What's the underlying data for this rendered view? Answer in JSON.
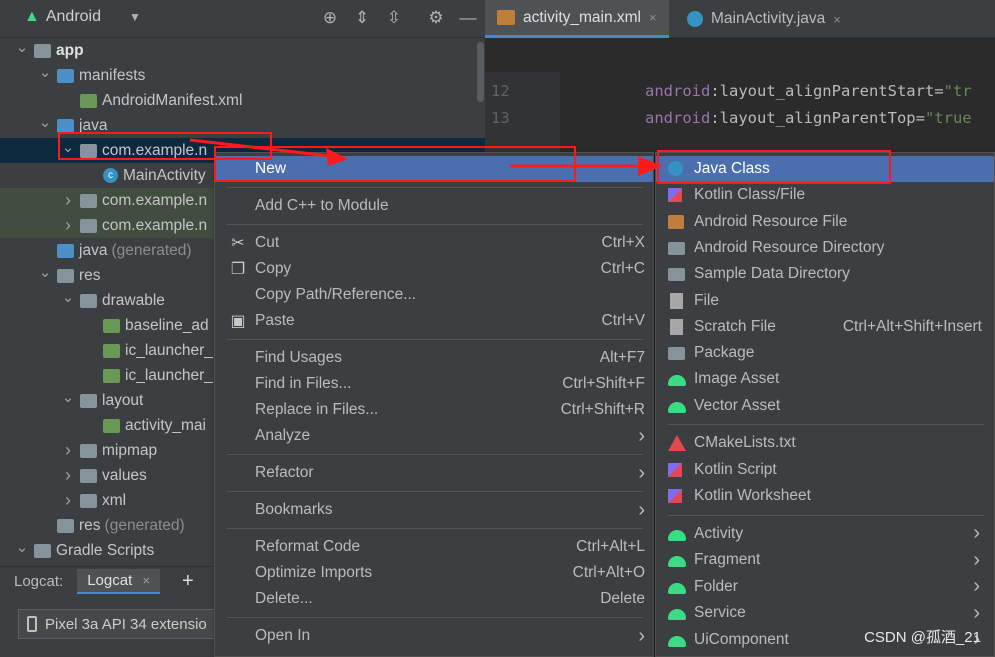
{
  "project_header": {
    "title": "Android",
    "icons": [
      "android-icon",
      "chevron-down-icon",
      "crosshair-icon",
      "expand-icon",
      "collapse-icon",
      "gear-icon",
      "minimize-icon"
    ]
  },
  "tree": [
    {
      "label": "app",
      "depth": 0,
      "arrow": "expanded",
      "icon": "module"
    },
    {
      "label": "manifests",
      "depth": 1,
      "arrow": "expanded",
      "icon": "folder-blue"
    },
    {
      "label": "AndroidManifest.xml",
      "depth": 2,
      "arrow": "",
      "icon": "manifest"
    },
    {
      "label": "java",
      "depth": 1,
      "arrow": "expanded",
      "icon": "folder-blue"
    },
    {
      "label": "com.example.n",
      "depth": 2,
      "arrow": "expanded",
      "icon": "package",
      "selected": true
    },
    {
      "label": "MainActivity",
      "depth": 3,
      "arrow": "",
      "icon": "java"
    },
    {
      "label": "com.example.n",
      "depth": 2,
      "arrow": "collapsed",
      "icon": "package",
      "green": true
    },
    {
      "label": "com.example.n",
      "depth": 2,
      "arrow": "collapsed",
      "icon": "package",
      "green": true
    },
    {
      "label": "java",
      "muted": "(generated)",
      "depth": 1,
      "arrow": "",
      "icon": "folder-gen"
    },
    {
      "label": "res",
      "depth": 1,
      "arrow": "expanded",
      "icon": "folder-res"
    },
    {
      "label": "drawable",
      "depth": 2,
      "arrow": "expanded",
      "icon": "folder"
    },
    {
      "label": "baseline_ad",
      "depth": 3,
      "arrow": "",
      "icon": "xml"
    },
    {
      "label": "ic_launcher_",
      "depth": 3,
      "arrow": "",
      "icon": "xml"
    },
    {
      "label": "ic_launcher_",
      "depth": 3,
      "arrow": "",
      "icon": "xml"
    },
    {
      "label": "layout",
      "depth": 2,
      "arrow": "expanded",
      "icon": "folder"
    },
    {
      "label": "activity_mai",
      "depth": 3,
      "arrow": "",
      "icon": "xml"
    },
    {
      "label": "mipmap",
      "depth": 2,
      "arrow": "collapsed",
      "icon": "folder"
    },
    {
      "label": "values",
      "depth": 2,
      "arrow": "collapsed",
      "icon": "folder"
    },
    {
      "label": "xml",
      "depth": 2,
      "arrow": "collapsed",
      "icon": "folder"
    },
    {
      "label": "res",
      "muted": "(generated)",
      "depth": 1,
      "arrow": "",
      "icon": "folder-res"
    },
    {
      "label": "Gradle Scripts",
      "depth": 0,
      "arrow": "expanded",
      "icon": "gradle"
    }
  ],
  "logcat": {
    "label": "Logcat:",
    "tab": "Logcat",
    "close": "×",
    "add": "+",
    "device": "Pixel 3a API 34 extensio"
  },
  "editor_tabs": [
    {
      "label": "activity_main.xml",
      "close": "×",
      "active": true
    },
    {
      "label": "MainActivity.java",
      "close": "×",
      "active": false
    }
  ],
  "code_lines": [
    {
      "num": "12",
      "ns": "android",
      "attr": ":layout_alignParentStart=",
      "val": "\"tr"
    },
    {
      "num": "13",
      "ns": "android",
      "attr": ":layout_alignParentTop=",
      "val": "\"true"
    }
  ],
  "menu": [
    {
      "label": "New",
      "hl": true,
      "sub": true,
      "icon": ""
    },
    {
      "sep": true
    },
    {
      "label": "Add C++ to Module",
      "icon": ""
    },
    {
      "sep": true
    },
    {
      "label": "Cut",
      "shortcut": "Ctrl+X",
      "icon": "scissors-icon"
    },
    {
      "label": "Copy",
      "shortcut": "Ctrl+C",
      "icon": "copy-icon"
    },
    {
      "label": "Copy Path/Reference...",
      "icon": ""
    },
    {
      "label": "Paste",
      "shortcut": "Ctrl+V",
      "icon": "clipboard-icon"
    },
    {
      "sep": true
    },
    {
      "label": "Find Usages",
      "shortcut": "Alt+F7",
      "icon": ""
    },
    {
      "label": "Find in Files...",
      "shortcut": "Ctrl+Shift+F",
      "icon": ""
    },
    {
      "label": "Replace in Files...",
      "shortcut": "Ctrl+Shift+R",
      "icon": ""
    },
    {
      "label": "Analyze",
      "sub": true,
      "icon": ""
    },
    {
      "sep": true
    },
    {
      "label": "Refactor",
      "sub": true,
      "icon": ""
    },
    {
      "sep": true
    },
    {
      "label": "Bookmarks",
      "sub": true,
      "icon": ""
    },
    {
      "sep": true
    },
    {
      "label": "Reformat Code",
      "shortcut": "Ctrl+Alt+L",
      "icon": ""
    },
    {
      "label": "Optimize Imports",
      "shortcut": "Ctrl+Alt+O",
      "icon": ""
    },
    {
      "label": "Delete...",
      "shortcut": "Delete",
      "icon": ""
    },
    {
      "sep": true
    },
    {
      "label": "Open In",
      "sub": true,
      "icon": ""
    }
  ],
  "submenu": [
    {
      "label": "Java Class",
      "hl": true,
      "icon": "java"
    },
    {
      "label": "Kotlin Class/File",
      "icon": "kotlin"
    },
    {
      "label": "Android Resource File",
      "icon": "xml"
    },
    {
      "label": "Android Resource Directory",
      "icon": "folder"
    },
    {
      "label": "Sample Data Directory",
      "icon": "folder"
    },
    {
      "label": "File",
      "icon": "file"
    },
    {
      "label": "Scratch File",
      "shortcut": "Ctrl+Alt+Shift+Insert",
      "icon": "file"
    },
    {
      "label": "Package",
      "icon": "folder"
    },
    {
      "label": "Image Asset",
      "icon": "android"
    },
    {
      "label": "Vector Asset",
      "icon": "android"
    },
    {
      "sep": true
    },
    {
      "label": "CMakeLists.txt",
      "icon": "cmake"
    },
    {
      "label": "Kotlin Script",
      "icon": "kotlin"
    },
    {
      "label": "Kotlin Worksheet",
      "icon": "kotlin"
    },
    {
      "sep": true
    },
    {
      "label": "Activity",
      "sub": true,
      "icon": "android"
    },
    {
      "label": "Fragment",
      "sub": true,
      "icon": "android"
    },
    {
      "label": "Folder",
      "sub": true,
      "icon": "android"
    },
    {
      "label": "Service",
      "sub": true,
      "icon": "android"
    },
    {
      "label": "UiComponent",
      "sub": true,
      "icon": "android"
    }
  ],
  "watermark": "CSDN @孤酒_21",
  "colors": {
    "highlight": "#4b6eaf",
    "annotation": "#ff1a1a",
    "selection": "#0d293e"
  }
}
